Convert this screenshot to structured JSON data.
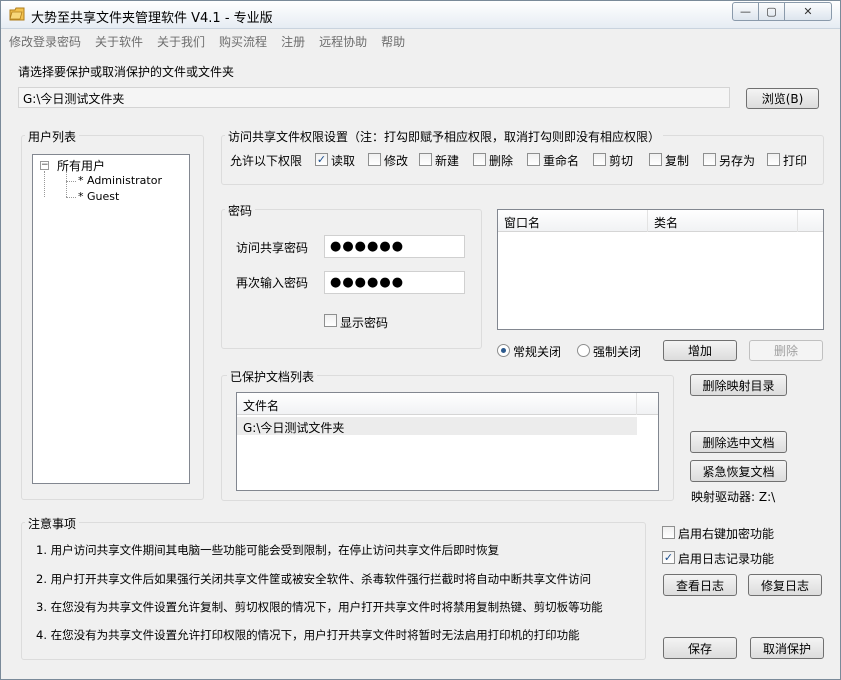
{
  "window": {
    "title": "大势至共享文件夹管理软件 V4.1 - 专业版",
    "controls": {
      "minimize": "—",
      "maximize": "▢",
      "close": "✕"
    }
  },
  "menu": [
    "修改登录密码",
    "关于软件",
    "关于我们",
    "购买流程",
    "注册",
    "远程协助",
    "帮助"
  ],
  "select_prompt": "请选择要保护或取消保护的文件或文件夹",
  "selected_path": "G:\\今日测试文件夹",
  "browse_button": "浏览(B)",
  "user_list": {
    "title": "用户列表",
    "root": "所有用户",
    "expander": "−",
    "users": [
      "* Administrator",
      "* Guest"
    ]
  },
  "permissions": {
    "title": "访问共享文件权限设置（注：打勾即赋予相应权限，取消打勾则即没有相应权限）",
    "allow_label": "允许以下权限",
    "items": [
      {
        "label": "读取",
        "checked": true
      },
      {
        "label": "修改",
        "checked": false
      },
      {
        "label": "新建",
        "checked": false
      },
      {
        "label": "删除",
        "checked": false
      },
      {
        "label": "重命名",
        "checked": false
      },
      {
        "label": "剪切",
        "checked": false
      },
      {
        "label": "复制",
        "checked": false
      },
      {
        "label": "另存为",
        "checked": false
      },
      {
        "label": "打印",
        "checked": false
      }
    ]
  },
  "password": {
    "title": "密码",
    "access_label": "访问共享密码",
    "access_value": "●●●●●●",
    "confirm_label": "再次输入密码",
    "confirm_value": "●●●●●●",
    "show_label": "显示密码",
    "show_checked": false
  },
  "window_list": {
    "columns": [
      "窗口名",
      "类名"
    ],
    "rows": []
  },
  "close_mode": {
    "normal": "常规关闭",
    "force": "强制关闭",
    "selected": "normal"
  },
  "add_button": "增加",
  "delete_button": "删除",
  "protected_list": {
    "title": "已保护文档列表",
    "column": "文件名",
    "rows": [
      "G:\\今日测试文件夹"
    ]
  },
  "delete_mapping_button": "删除映射目录",
  "delete_selected_button": "删除选中文档",
  "emergency_restore_button": "紧急恢复文档",
  "mapped_drive": "映射驱动器: Z:\\",
  "notes": {
    "title": "注意事项",
    "items": [
      "1. 用户访问共享文件期间其电脑一些功能可能会受到限制，在停止访问共享文件后即时恢复",
      "2. 用户打开共享文件后如果强行关闭共享文件筐或被安全软件、杀毒软件强行拦截时将自动中断共享文件访问",
      "3. 在您没有为共享文件设置允许复制、剪切权限的情况下，用户打开共享文件时将禁用复制热键、剪切板等功能",
      "4. 在您没有为共享文件设置允许打印权限的情况下，用户打开共享文件时将暂时无法启用打印机的打印功能"
    ]
  },
  "options": [
    {
      "label": "启用右键加密功能",
      "checked": false
    },
    {
      "label": "启用日志记录功能",
      "checked": true
    }
  ],
  "view_log_button": "查看日志",
  "repair_log_button": "修复日志",
  "save_button": "保存",
  "cancel_protect_button": "取消保护",
  "check_mark": "✓"
}
